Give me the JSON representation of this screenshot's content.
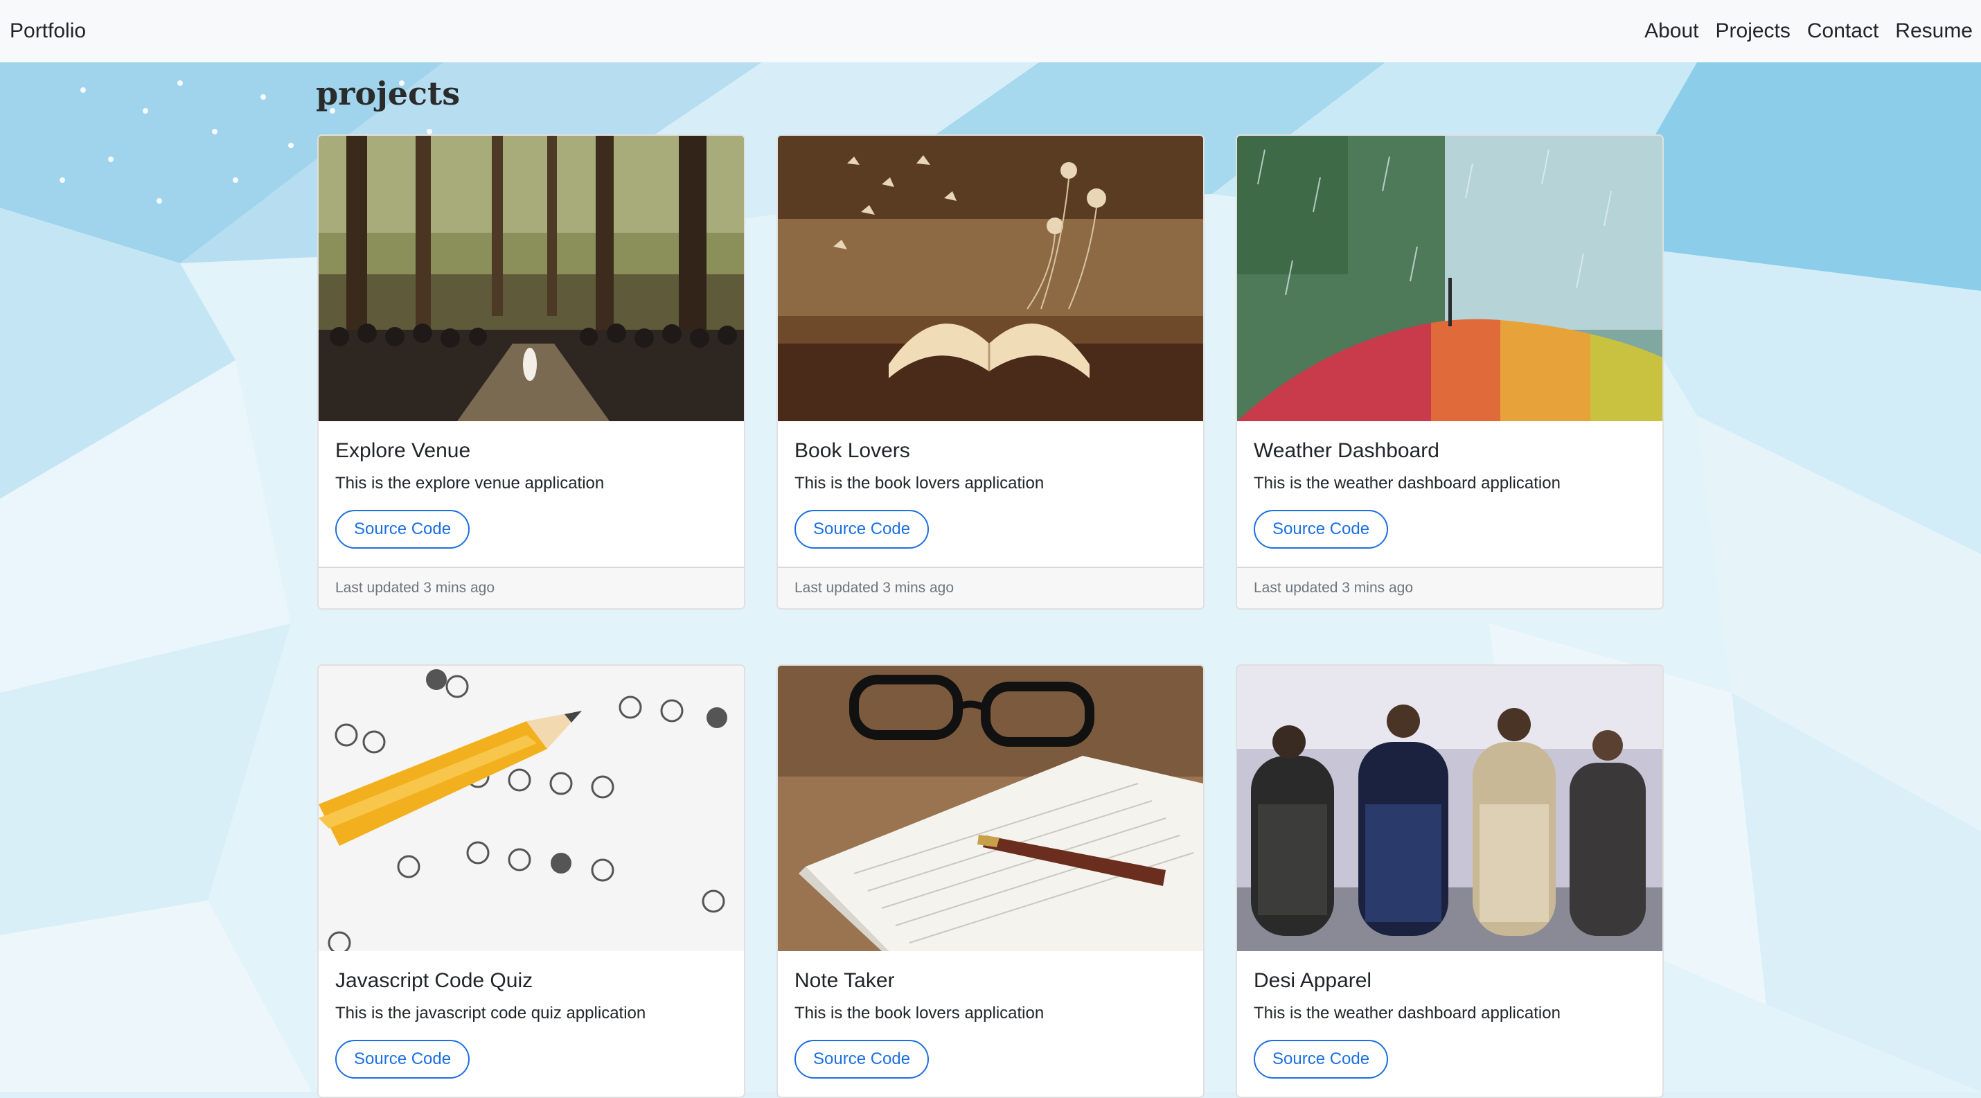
{
  "navbar": {
    "brand": "Portfolio",
    "links": [
      "About",
      "Projects",
      "Contact",
      "Resume"
    ]
  },
  "page": {
    "heading": "projects"
  },
  "projects": [
    {
      "title": "Explore Venue",
      "text": "This is the explore venue application",
      "button": "Source Code",
      "footer": "Last updated 3 mins ago",
      "image": "forest wedding ceremony"
    },
    {
      "title": "Book Lovers",
      "text": "This is the book lovers application",
      "button": "Source Code",
      "footer": "Last updated 3 mins ago",
      "image": "open book with butterflies"
    },
    {
      "title": "Weather Dashboard",
      "text": "This is the weather dashboard application",
      "button": "Source Code",
      "footer": "Last updated 3 mins ago",
      "image": "rainbow umbrella in rain"
    },
    {
      "title": "Javascript Code Quiz",
      "text": "This is the javascript code quiz application",
      "button": "Source Code",
      "image": "pencil on answer sheet"
    },
    {
      "title": "Note Taker",
      "text": "This is the book lovers application",
      "button": "Source Code",
      "image": "glasses, notebook and pen"
    },
    {
      "title": "Desi Apparel",
      "text": "This is the weather dashboard application",
      "button": "Source Code",
      "image": "models on runway"
    }
  ],
  "colors": {
    "accent": "#1c6fe0",
    "navbar_bg": "#f8f9fa",
    "footer_bg": "#f7f7f7"
  }
}
